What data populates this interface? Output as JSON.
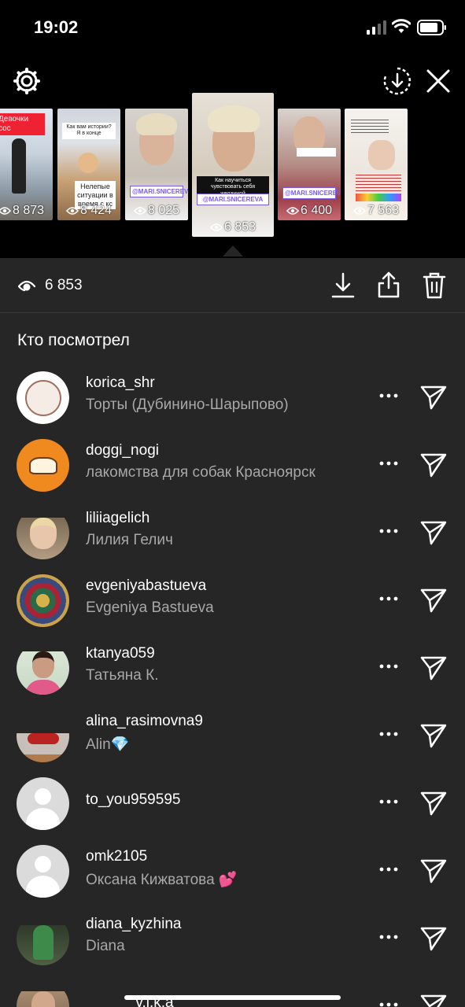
{
  "status_bar": {
    "time": "19:02"
  },
  "strip": {
    "thumbs": [
      {
        "views": "8 873",
        "caption": "Девочки сос"
      },
      {
        "views": "8 424",
        "caption": "Как вам истории? Я в конце",
        "caption2": "Нелепые ситуации в время с кс"
      },
      {
        "views": "8 025",
        "tag": "@MARI.SNICEREVA"
      },
      {
        "views": "6 853",
        "caption": "Как научиться чувствовать себя желанной",
        "tag": "@MARI.SNICEREVA",
        "selected": true
      },
      {
        "views": "6 400",
        "tag": "@MARI.SNICEREVA"
      },
      {
        "views": "7 563"
      }
    ]
  },
  "stats": {
    "views": "6 853"
  },
  "viewers_title": "Кто посмотрел",
  "viewers": [
    {
      "username": "korica_shr",
      "name": "Торты (Дубинино-Шарыпово)",
      "avatar": "korica"
    },
    {
      "username": "doggi_nogi",
      "name": "лакомства для собак Красноярск",
      "avatar": "doggi"
    },
    {
      "username": "liliiagelich",
      "name": "Лилия Гелич",
      "avatar": "photo1"
    },
    {
      "username": "evgeniyabastueva",
      "name": "Evgeniya Bastueva",
      "avatar": "mandala"
    },
    {
      "username": "ktanya059",
      "name": "Татьяна К.",
      "avatar": "photo2"
    },
    {
      "username": "alina_rasimovna9",
      "name": "Alin💎",
      "avatar": "photo3"
    },
    {
      "username": "to_you959595",
      "name": "",
      "avatar": "default"
    },
    {
      "username": "omk2105",
      "name": "Оксана Кижватова 💕",
      "avatar": "default"
    },
    {
      "username": "diana_kyzhina",
      "name": "Diana",
      "avatar": "photo4"
    },
    {
      "username": "______v.i.k.a______",
      "name": "",
      "avatar": "photo5"
    }
  ],
  "colors": {
    "sheet_bg": "#262626",
    "secondary_text": "#a8a8a8",
    "tag_purple": "#7a5ce0"
  }
}
